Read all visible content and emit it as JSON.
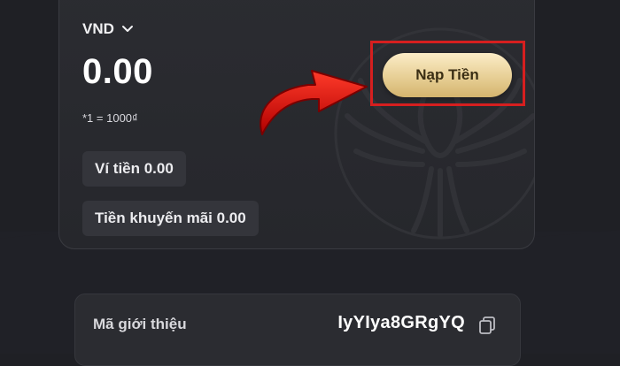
{
  "wallet": {
    "currency": "VND",
    "balance": "0.00",
    "rate_note": "*1 = 1000₫",
    "wallet_balance": "Ví tiền 0.00",
    "promo_balance": "Tiền khuyến mãi 0.00"
  },
  "actions": {
    "deposit_label": "Nạp Tiền"
  },
  "referral": {
    "label": "Mã giới thiệu",
    "code": "IyYIya8GRgYQ"
  },
  "colors": {
    "background": "#1f2025",
    "card": "#2b2c31",
    "deposit_gold": "#e7cf95",
    "highlight_red": "#d61f1f",
    "arrow_red": "#e01010"
  },
  "icons": {
    "currency_dropdown": "chevron-down-icon",
    "copy": "copy-icon",
    "pointer": "arrow-annotation"
  }
}
